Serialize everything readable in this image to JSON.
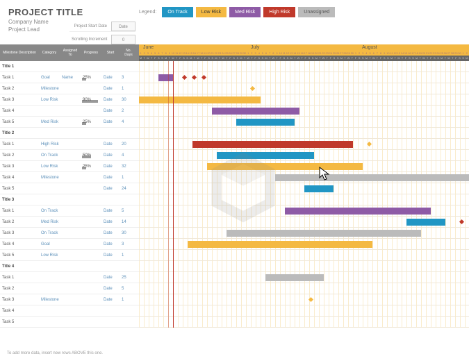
{
  "header": {
    "title": "PROJECT TITLE",
    "company": "Company Name",
    "lead": "Project Lead"
  },
  "controls": {
    "start_label": "Project Start Date",
    "start_value": "Date",
    "scroll_label": "Scrolling Increment",
    "scroll_value": "0"
  },
  "legend": {
    "label": "Legend:",
    "items": [
      {
        "key": "ontrack",
        "label": "On Track"
      },
      {
        "key": "low",
        "label": "Low Risk"
      },
      {
        "key": "med",
        "label": "Med Risk"
      },
      {
        "key": "high",
        "label": "High Risk"
      },
      {
        "key": "un",
        "label": "Unassigned"
      }
    ]
  },
  "table": {
    "headers": {
      "desc": "Milestone Description",
      "cat": "Category",
      "assn": "Assigned To",
      "prog": "Progress",
      "start": "Start",
      "days": "No. Days"
    }
  },
  "months": [
    {
      "name": "June",
      "days": 30,
      "offset": 0
    },
    {
      "name": "July",
      "days": 31,
      "offset": 30
    },
    {
      "name": "August",
      "days": 31,
      "offset": 61
    }
  ],
  "today_col": 7,
  "rows": [
    {
      "type": "title",
      "desc": "Title 1"
    },
    {
      "type": "task",
      "desc": "Task 1",
      "cat": "Goal",
      "assn": "Name",
      "prog": 25,
      "start": "Date",
      "days": 3,
      "bar": {
        "start": 4,
        "len": 3,
        "color": "#8e5ba6"
      },
      "milestones": [
        {
          "col": 9,
          "cls": "d-red"
        },
        {
          "col": 11,
          "cls": "d-red"
        },
        {
          "col": 13,
          "cls": "d-red"
        }
      ]
    },
    {
      "type": "task",
      "desc": "Task 2",
      "cat": "Milestone",
      "assn": "",
      "prog": null,
      "start": "Date",
      "days": 1,
      "milestones": [
        {
          "col": 23,
          "cls": "d-yel"
        }
      ]
    },
    {
      "type": "task",
      "desc": "Task 3",
      "cat": "Low Risk",
      "assn": "",
      "prog": 90,
      "start": "Date",
      "days": 30,
      "bar": {
        "start": -5,
        "len": 30,
        "color": "#f4b942"
      }
    },
    {
      "type": "task",
      "desc": "Task 4",
      "cat": "",
      "assn": "",
      "prog": null,
      "start": "Date",
      "days": 2,
      "bar": {
        "start": 15,
        "len": 18,
        "color": "#8e5ba6"
      }
    },
    {
      "type": "task",
      "desc": "Task 5",
      "cat": "Med Risk",
      "assn": "",
      "prog": 25,
      "start": "Date",
      "days": 4,
      "bar": {
        "start": 20,
        "len": 12,
        "color": "#2196c4"
      }
    },
    {
      "type": "title",
      "desc": "Title 2"
    },
    {
      "type": "task",
      "desc": "Task 1",
      "cat": "High Risk",
      "assn": "",
      "prog": null,
      "start": "Date",
      "days": 20,
      "bar": {
        "start": 11,
        "len": 33,
        "color": "#c0392b"
      },
      "milestones": [
        {
          "col": 47,
          "cls": "d-yel"
        }
      ]
    },
    {
      "type": "task",
      "desc": "Task 2",
      "cat": "On Track",
      "assn": "",
      "prog": 50,
      "start": "Date",
      "days": 4,
      "bar": {
        "start": 16,
        "len": 20,
        "color": "#2196c4"
      }
    },
    {
      "type": "task",
      "desc": "Task 3",
      "cat": "Low Risk",
      "assn": "",
      "prog": 25,
      "start": "Date",
      "days": 32,
      "bar": {
        "start": 14,
        "len": 32,
        "color": "#f4b942"
      }
    },
    {
      "type": "task",
      "desc": "Task 4",
      "cat": "Milestone",
      "assn": "",
      "prog": null,
      "start": "Date",
      "days": 1,
      "bar": {
        "start": 28,
        "len": 40,
        "color": "#bbb"
      }
    },
    {
      "type": "task",
      "desc": "Task 5",
      "cat": "",
      "assn": "",
      "prog": null,
      "start": "Date",
      "days": 24,
      "bar": {
        "start": 34,
        "len": 6,
        "color": "#2196c4"
      }
    },
    {
      "type": "title",
      "desc": "Title 3"
    },
    {
      "type": "task",
      "desc": "Task 1",
      "cat": "On Track",
      "assn": "",
      "prog": null,
      "start": "Date",
      "days": 5,
      "bar": {
        "start": 30,
        "len": 30,
        "color": "#8e5ba6"
      }
    },
    {
      "type": "task",
      "desc": "Task 2",
      "cat": "Med Risk",
      "assn": "",
      "prog": null,
      "start": "Date",
      "days": 14,
      "bar": {
        "start": 55,
        "len": 8,
        "color": "#2196c4"
      },
      "milestones": [
        {
          "col": 66,
          "cls": "d-red"
        },
        {
          "col": 68,
          "cls": "d-red"
        },
        {
          "col": 70,
          "cls": "d-red"
        }
      ]
    },
    {
      "type": "task",
      "desc": "Task 3",
      "cat": "On Track",
      "assn": "",
      "prog": null,
      "start": "Date",
      "days": 30,
      "bar": {
        "start": 18,
        "len": 40,
        "color": "#bbb"
      }
    },
    {
      "type": "task",
      "desc": "Task 4",
      "cat": "Goal",
      "assn": "",
      "prog": null,
      "start": "Date",
      "days": 3,
      "bar": {
        "start": 10,
        "len": 38,
        "color": "#f4b942"
      }
    },
    {
      "type": "task",
      "desc": "Task 5",
      "cat": "Low Risk",
      "assn": "",
      "prog": null,
      "start": "Date",
      "days": 1
    },
    {
      "type": "title",
      "desc": "Title 4"
    },
    {
      "type": "task",
      "desc": "Task 1",
      "cat": "",
      "assn": "",
      "prog": null,
      "start": "Date",
      "days": 25,
      "bar": {
        "start": 26,
        "len": 12,
        "color": "#bbb"
      }
    },
    {
      "type": "task",
      "desc": "Task 2",
      "cat": "",
      "assn": "",
      "prog": null,
      "start": "Date",
      "days": 5
    },
    {
      "type": "task",
      "desc": "Task 3",
      "cat": "Milestone",
      "assn": "",
      "prog": null,
      "start": "Date",
      "days": 1,
      "milestones": [
        {
          "col": 35,
          "cls": "d-yel"
        }
      ]
    },
    {
      "type": "task",
      "desc": "Task 4",
      "cat": "",
      "assn": "",
      "prog": null,
      "start": "",
      "days": ""
    },
    {
      "type": "task",
      "desc": "Task 5",
      "cat": "",
      "assn": "",
      "prog": null,
      "start": "",
      "days": ""
    }
  ],
  "footer": "To add more data, insert new rows ABOVE this one.",
  "chart_data": {
    "type": "gantt",
    "title": "PROJECT TITLE",
    "xlabel": "Date",
    "x_range": [
      "June",
      "July",
      "August"
    ],
    "today_marker": "June 7",
    "legend": [
      "On Track",
      "Low Risk",
      "Med Risk",
      "High Risk",
      "Unassigned"
    ],
    "groups": [
      {
        "name": "Title 1",
        "tasks": [
          {
            "name": "Task 1",
            "category": "Goal",
            "assigned": "Name",
            "progress": 25,
            "start_offset": 4,
            "duration": 3
          },
          {
            "name": "Task 2",
            "category": "Milestone",
            "start_offset": 23,
            "duration": 1
          },
          {
            "name": "Task 3",
            "category": "Low Risk",
            "progress": 90,
            "start_offset": -5,
            "duration": 30
          },
          {
            "name": "Task 4",
            "start_offset": 15,
            "duration": 2
          },
          {
            "name": "Task 5",
            "category": "Med Risk",
            "progress": 25,
            "start_offset": 20,
            "duration": 4
          }
        ]
      },
      {
        "name": "Title 2",
        "tasks": [
          {
            "name": "Task 1",
            "category": "High Risk",
            "start_offset": 11,
            "duration": 20
          },
          {
            "name": "Task 2",
            "category": "On Track",
            "progress": 50,
            "start_offset": 16,
            "duration": 4
          },
          {
            "name": "Task 3",
            "category": "Low Risk",
            "progress": 25,
            "start_offset": 14,
            "duration": 32
          },
          {
            "name": "Task 4",
            "category": "Milestone",
            "start_offset": 28,
            "duration": 1
          },
          {
            "name": "Task 5",
            "start_offset": 34,
            "duration": 24
          }
        ]
      },
      {
        "name": "Title 3",
        "tasks": [
          {
            "name": "Task 1",
            "category": "On Track",
            "start_offset": 30,
            "duration": 5
          },
          {
            "name": "Task 2",
            "category": "Med Risk",
            "start_offset": 55,
            "duration": 14
          },
          {
            "name": "Task 3",
            "category": "On Track",
            "start_offset": 18,
            "duration": 30
          },
          {
            "name": "Task 4",
            "category": "Goal",
            "start_offset": 10,
            "duration": 3
          },
          {
            "name": "Task 5",
            "category": "Low Risk",
            "duration": 1
          }
        ]
      },
      {
        "name": "Title 4",
        "tasks": [
          {
            "name": "Task 1",
            "start_offset": 26,
            "duration": 25
          },
          {
            "name": "Task 2",
            "duration": 5
          },
          {
            "name": "Task 3",
            "category": "Milestone",
            "duration": 1
          },
          {
            "name": "Task 4"
          },
          {
            "name": "Task 5"
          }
        ]
      }
    ]
  }
}
